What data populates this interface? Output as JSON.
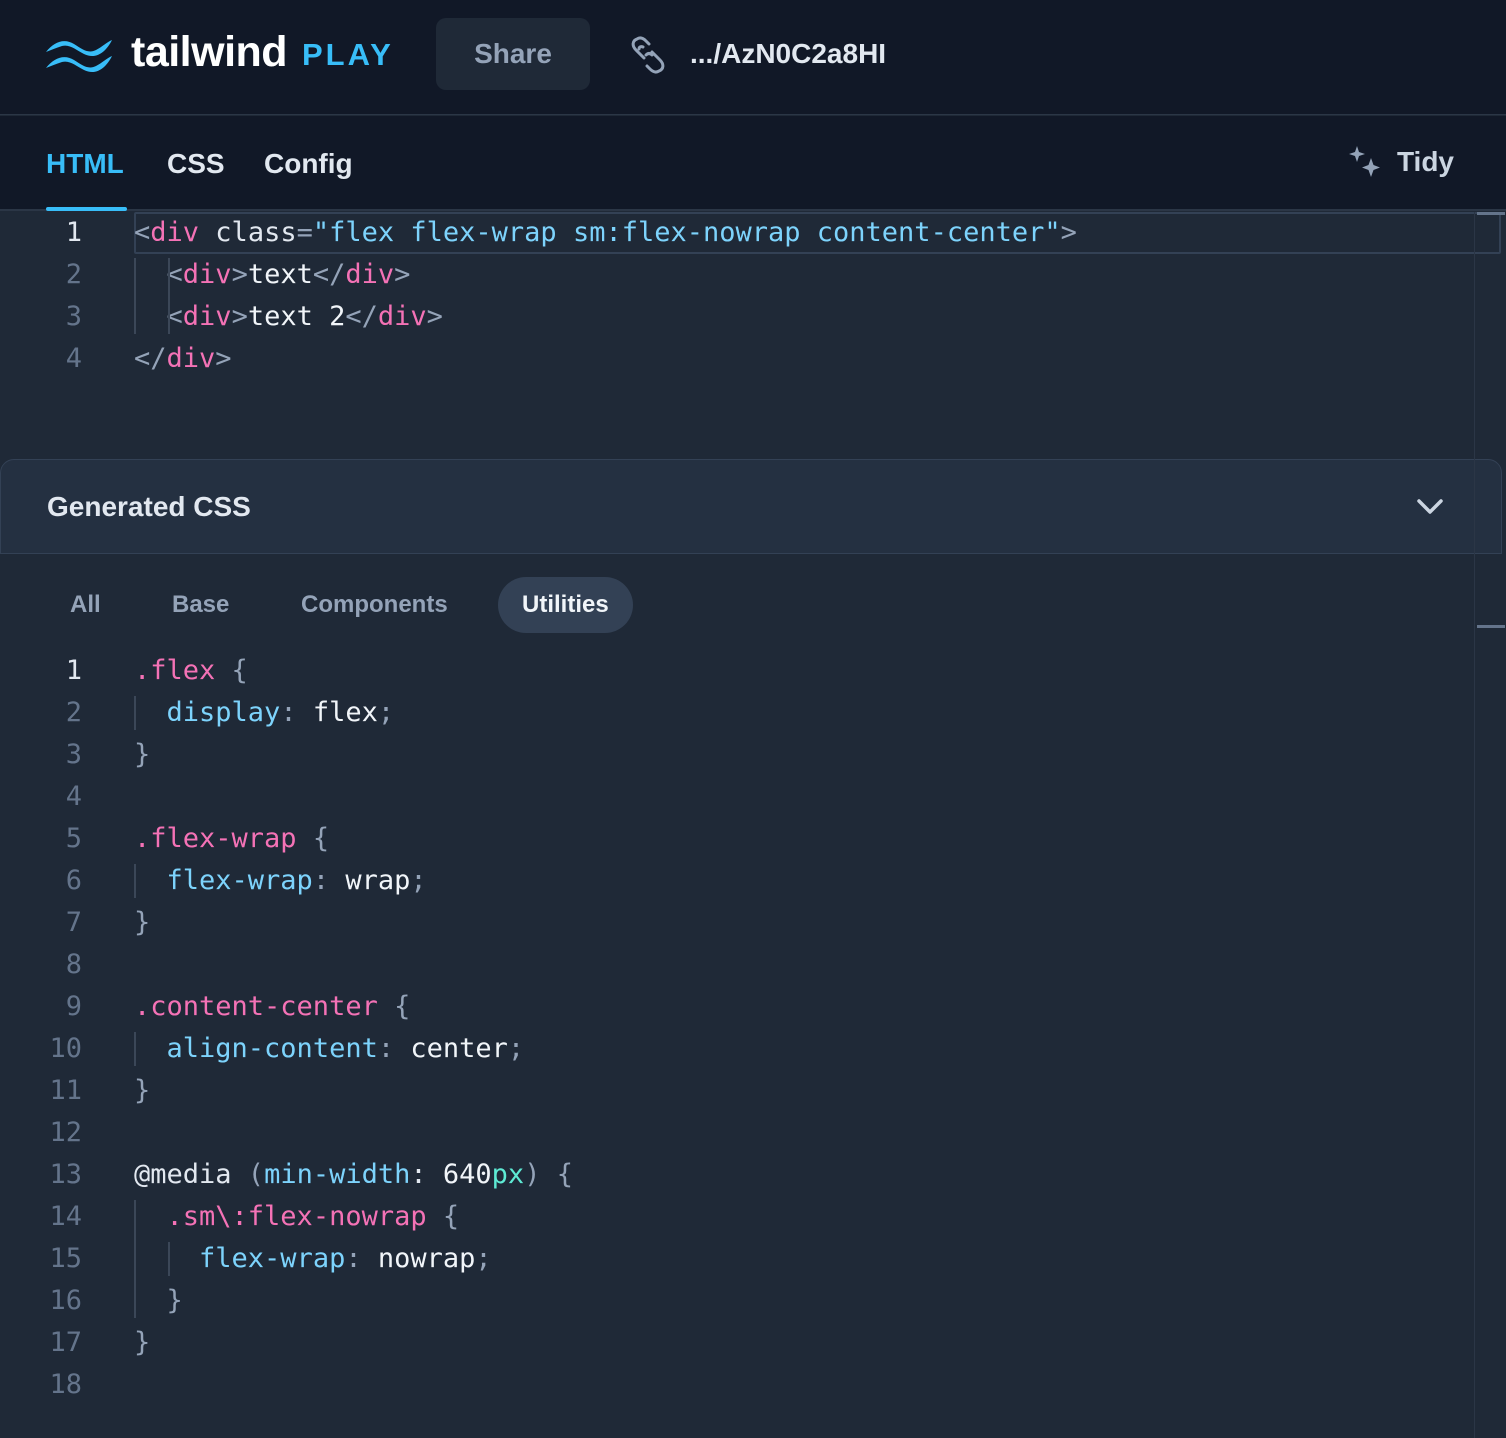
{
  "header": {
    "logo_word": "tailwind",
    "logo_play": "PLAY",
    "share_label": "Share",
    "share_url": ".../AzN0C2a8HI"
  },
  "tabs": [
    {
      "label": "HTML",
      "active": true
    },
    {
      "label": "CSS",
      "active": false
    },
    {
      "label": "Config",
      "active": false
    }
  ],
  "tidy_label": "Tidy",
  "html_code": {
    "line_numbers": [
      "1",
      "2",
      "3",
      "4"
    ],
    "lines": [
      [
        [
          "<",
          "punc"
        ],
        [
          "div",
          "tag"
        ],
        [
          " class",
          "attr"
        ],
        [
          "=",
          "punc"
        ],
        [
          "\"flex flex-wrap sm:flex-nowrap content-center\"",
          "str"
        ],
        [
          ">",
          "punc"
        ]
      ],
      [
        [
          "  ",
          "text"
        ],
        [
          "<",
          "punc"
        ],
        [
          "div",
          "tag"
        ],
        [
          ">",
          "punc"
        ],
        [
          "text",
          "text"
        ],
        [
          "</",
          "punc"
        ],
        [
          "div",
          "tag"
        ],
        [
          ">",
          "punc"
        ]
      ],
      [
        [
          "  ",
          "text"
        ],
        [
          "<",
          "punc"
        ],
        [
          "div",
          "tag"
        ],
        [
          ">",
          "punc"
        ],
        [
          "text 2",
          "text"
        ],
        [
          "</",
          "punc"
        ],
        [
          "div",
          "tag"
        ],
        [
          ">",
          "punc"
        ]
      ],
      [
        [
          "</",
          "punc"
        ],
        [
          "div",
          "tag"
        ],
        [
          ">",
          "punc"
        ]
      ]
    ]
  },
  "generated_css": {
    "title": "Generated CSS",
    "filters": [
      {
        "label": "All",
        "selected": false
      },
      {
        "label": "Base",
        "selected": false
      },
      {
        "label": "Components",
        "selected": false
      },
      {
        "label": "Utilities",
        "selected": true
      }
    ],
    "line_numbers": [
      "1",
      "2",
      "3",
      "4",
      "5",
      "6",
      "7",
      "8",
      "9",
      "10",
      "11",
      "12",
      "13",
      "14",
      "15",
      "16",
      "17",
      "18"
    ],
    "lines": [
      [
        [
          ".flex",
          "sel"
        ],
        [
          " {",
          "punc"
        ]
      ],
      [
        [
          "  ",
          "text"
        ],
        [
          "display",
          "prop"
        ],
        [
          ":",
          "punc"
        ],
        [
          " flex",
          "val"
        ],
        [
          ";",
          "punc"
        ]
      ],
      [
        [
          "}",
          "punc"
        ]
      ],
      [],
      [
        [
          ".flex-wrap",
          "sel"
        ],
        [
          " {",
          "punc"
        ]
      ],
      [
        [
          "  ",
          "text"
        ],
        [
          "flex-wrap",
          "prop"
        ],
        [
          ":",
          "punc"
        ],
        [
          " wrap",
          "val"
        ],
        [
          ";",
          "punc"
        ]
      ],
      [
        [
          "}",
          "punc"
        ]
      ],
      [],
      [
        [
          ".content-center",
          "sel"
        ],
        [
          " {",
          "punc"
        ]
      ],
      [
        [
          "  ",
          "text"
        ],
        [
          "align-content",
          "prop"
        ],
        [
          ":",
          "punc"
        ],
        [
          " center",
          "val"
        ],
        [
          ";",
          "punc"
        ]
      ],
      [
        [
          "}",
          "punc"
        ]
      ],
      [],
      [
        [
          "@media",
          "at"
        ],
        [
          " (",
          "punc"
        ],
        [
          "min-width",
          "prop"
        ],
        [
          ": ",
          "at"
        ],
        [
          "640",
          "val"
        ],
        [
          "px",
          "unit"
        ],
        [
          ")",
          "punc"
        ],
        [
          " {",
          "punc"
        ]
      ],
      [
        [
          "  ",
          "text"
        ],
        [
          ".sm\\:flex-nowrap",
          "sel"
        ],
        [
          " {",
          "punc"
        ]
      ],
      [
        [
          "    ",
          "text"
        ],
        [
          "flex-wrap",
          "prop"
        ],
        [
          ":",
          "punc"
        ],
        [
          " nowrap",
          "val"
        ],
        [
          ";",
          "punc"
        ]
      ],
      [
        [
          "  ",
          "text"
        ],
        [
          "}",
          "punc"
        ]
      ],
      [
        [
          "}",
          "punc"
        ]
      ],
      []
    ]
  },
  "colors": {
    "accent": "#38bdf8",
    "background": "#1f2937",
    "header_bg": "#111827",
    "tag": "#f472b6",
    "string": "#7dd3fc"
  },
  "icons": {
    "logo": "tailwind-logo-icon",
    "link": "link-icon",
    "tidy": "sparkles-icon",
    "collapse": "chevron-down-icon"
  }
}
